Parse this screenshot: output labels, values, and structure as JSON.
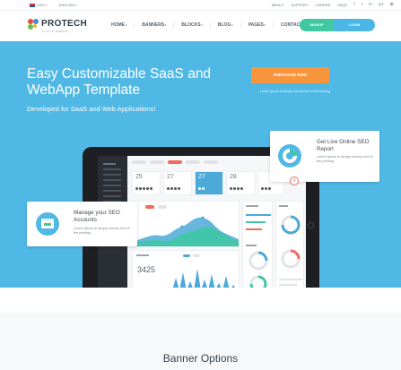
{
  "topbar": {
    "currency": "USD",
    "language": "ENGLISH",
    "links": [
      "ABOUT",
      "SUPPORT",
      "CAREER",
      "FAQS"
    ],
    "social_icons": [
      "facebook-icon",
      "twitter-icon",
      "linkedin-icon",
      "google-plus-icon",
      "rss-icon"
    ]
  },
  "brand": {
    "name": "PROTECH",
    "tagline": "SAAS & WEBAPP",
    "colors": {
      "red": "#e94b3c",
      "blue": "#3f8fd6",
      "green": "#6cc04a",
      "yellow": "#f7b234"
    }
  },
  "nav": {
    "items": [
      {
        "label": "HOME",
        "dropdown": true
      },
      {
        "label": "BANNERS",
        "dropdown": true
      },
      {
        "label": "BLOCKS",
        "dropdown": true
      },
      {
        "label": "BLOG",
        "dropdown": true
      },
      {
        "label": "PAGES",
        "dropdown": true
      },
      {
        "label": "CONTACT",
        "dropdown": false
      }
    ],
    "signup_label": "SIGNUP",
    "login_label": "LOGIN"
  },
  "hero": {
    "title": "Easy Customizable SaaS and WebApp Template",
    "subtitle": "Developed for SaaS and Web Applications!",
    "purchase_label": "PURCHASE NOW",
    "purchase_note": "Lorem ipsum is simply dummy text of the printing",
    "bg_color": "#50b8e5",
    "accent_color": "#f7963c"
  },
  "callouts": {
    "seo_report": {
      "title": "Get Live Online SEO Report",
      "text": "Lorem ipsum is simply dummy text of the printing"
    },
    "seo_accounts": {
      "title": "Manage your SEO Accounts",
      "text": "Lorem ipsum is simply dummy text of the printing"
    }
  },
  "dashboard": {
    "stats": [
      "25",
      "27",
      "27",
      "28"
    ],
    "big_number": "3425"
  },
  "section": {
    "heading": "Banner Options"
  }
}
